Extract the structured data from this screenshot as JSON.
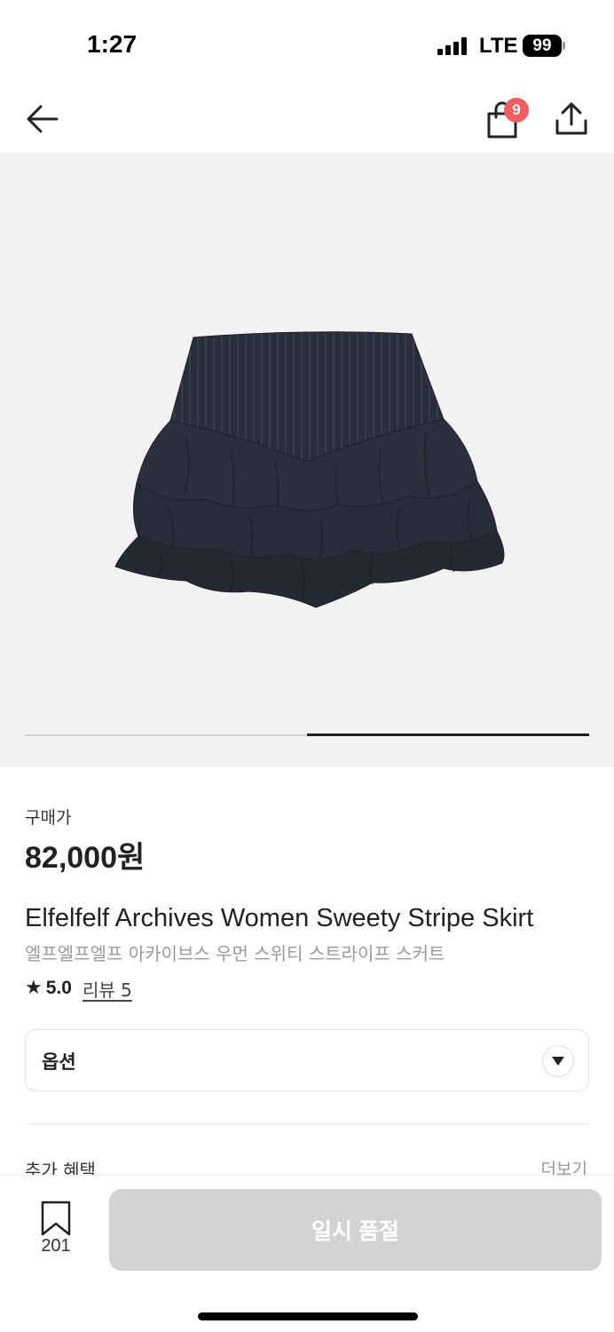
{
  "status_bar": {
    "time": "1:27",
    "network": "LTE",
    "battery": "99"
  },
  "header": {
    "cart_count": "9",
    "icons": [
      "back-arrow-icon",
      "shopping-bag-icon",
      "share-icon"
    ]
  },
  "gallery": {
    "image_name": "striped-tiered-ruffle-skirt",
    "slide_index": 2,
    "slide_total": 2
  },
  "product": {
    "price_label": "구매가",
    "price": "82,000원",
    "name_en": "Elfelfelf Archives Women Sweety Stripe Skirt",
    "name_ko": "엘프엘프엘프 아카이브스 우먼 스위티 스트라이프 스커트",
    "rating_star": "★",
    "rating": "5.0",
    "review_link": "리뷰 5"
  },
  "options": {
    "label": "옵션"
  },
  "benefits": {
    "label": "추가 혜택",
    "more": "더보기"
  },
  "bottom_bar": {
    "bookmark_count": "201",
    "action_label": "일시 품절"
  },
  "colors": {
    "badge": "#ef5f5f",
    "disabled_button": "#d3d3d3",
    "image_bg": "#f2f2f2",
    "skirt": "#2b2d3a"
  }
}
